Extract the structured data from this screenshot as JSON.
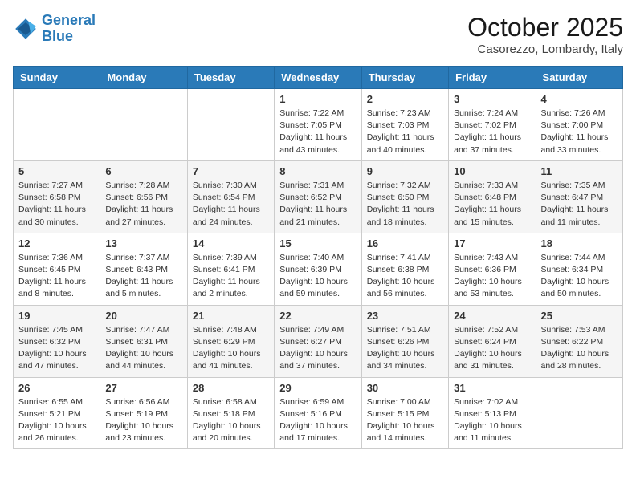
{
  "logo": {
    "line1": "General",
    "line2": "Blue"
  },
  "title": "October 2025",
  "subtitle": "Casorezzo, Lombardy, Italy",
  "weekdays": [
    "Sunday",
    "Monday",
    "Tuesday",
    "Wednesday",
    "Thursday",
    "Friday",
    "Saturday"
  ],
  "weeks": [
    [
      {
        "day": "",
        "info": ""
      },
      {
        "day": "",
        "info": ""
      },
      {
        "day": "",
        "info": ""
      },
      {
        "day": "1",
        "info": "Sunrise: 7:22 AM\nSunset: 7:05 PM\nDaylight: 11 hours\nand 43 minutes."
      },
      {
        "day": "2",
        "info": "Sunrise: 7:23 AM\nSunset: 7:03 PM\nDaylight: 11 hours\nand 40 minutes."
      },
      {
        "day": "3",
        "info": "Sunrise: 7:24 AM\nSunset: 7:02 PM\nDaylight: 11 hours\nand 37 minutes."
      },
      {
        "day": "4",
        "info": "Sunrise: 7:26 AM\nSunset: 7:00 PM\nDaylight: 11 hours\nand 33 minutes."
      }
    ],
    [
      {
        "day": "5",
        "info": "Sunrise: 7:27 AM\nSunset: 6:58 PM\nDaylight: 11 hours\nand 30 minutes."
      },
      {
        "day": "6",
        "info": "Sunrise: 7:28 AM\nSunset: 6:56 PM\nDaylight: 11 hours\nand 27 minutes."
      },
      {
        "day": "7",
        "info": "Sunrise: 7:30 AM\nSunset: 6:54 PM\nDaylight: 11 hours\nand 24 minutes."
      },
      {
        "day": "8",
        "info": "Sunrise: 7:31 AM\nSunset: 6:52 PM\nDaylight: 11 hours\nand 21 minutes."
      },
      {
        "day": "9",
        "info": "Sunrise: 7:32 AM\nSunset: 6:50 PM\nDaylight: 11 hours\nand 18 minutes."
      },
      {
        "day": "10",
        "info": "Sunrise: 7:33 AM\nSunset: 6:48 PM\nDaylight: 11 hours\nand 15 minutes."
      },
      {
        "day": "11",
        "info": "Sunrise: 7:35 AM\nSunset: 6:47 PM\nDaylight: 11 hours\nand 11 minutes."
      }
    ],
    [
      {
        "day": "12",
        "info": "Sunrise: 7:36 AM\nSunset: 6:45 PM\nDaylight: 11 hours\nand 8 minutes."
      },
      {
        "day": "13",
        "info": "Sunrise: 7:37 AM\nSunset: 6:43 PM\nDaylight: 11 hours\nand 5 minutes."
      },
      {
        "day": "14",
        "info": "Sunrise: 7:39 AM\nSunset: 6:41 PM\nDaylight: 11 hours\nand 2 minutes."
      },
      {
        "day": "15",
        "info": "Sunrise: 7:40 AM\nSunset: 6:39 PM\nDaylight: 10 hours\nand 59 minutes."
      },
      {
        "day": "16",
        "info": "Sunrise: 7:41 AM\nSunset: 6:38 PM\nDaylight: 10 hours\nand 56 minutes."
      },
      {
        "day": "17",
        "info": "Sunrise: 7:43 AM\nSunset: 6:36 PM\nDaylight: 10 hours\nand 53 minutes."
      },
      {
        "day": "18",
        "info": "Sunrise: 7:44 AM\nSunset: 6:34 PM\nDaylight: 10 hours\nand 50 minutes."
      }
    ],
    [
      {
        "day": "19",
        "info": "Sunrise: 7:45 AM\nSunset: 6:32 PM\nDaylight: 10 hours\nand 47 minutes."
      },
      {
        "day": "20",
        "info": "Sunrise: 7:47 AM\nSunset: 6:31 PM\nDaylight: 10 hours\nand 44 minutes."
      },
      {
        "day": "21",
        "info": "Sunrise: 7:48 AM\nSunset: 6:29 PM\nDaylight: 10 hours\nand 41 minutes."
      },
      {
        "day": "22",
        "info": "Sunrise: 7:49 AM\nSunset: 6:27 PM\nDaylight: 10 hours\nand 37 minutes."
      },
      {
        "day": "23",
        "info": "Sunrise: 7:51 AM\nSunset: 6:26 PM\nDaylight: 10 hours\nand 34 minutes."
      },
      {
        "day": "24",
        "info": "Sunrise: 7:52 AM\nSunset: 6:24 PM\nDaylight: 10 hours\nand 31 minutes."
      },
      {
        "day": "25",
        "info": "Sunrise: 7:53 AM\nSunset: 6:22 PM\nDaylight: 10 hours\nand 28 minutes."
      }
    ],
    [
      {
        "day": "26",
        "info": "Sunrise: 6:55 AM\nSunset: 5:21 PM\nDaylight: 10 hours\nand 26 minutes."
      },
      {
        "day": "27",
        "info": "Sunrise: 6:56 AM\nSunset: 5:19 PM\nDaylight: 10 hours\nand 23 minutes."
      },
      {
        "day": "28",
        "info": "Sunrise: 6:58 AM\nSunset: 5:18 PM\nDaylight: 10 hours\nand 20 minutes."
      },
      {
        "day": "29",
        "info": "Sunrise: 6:59 AM\nSunset: 5:16 PM\nDaylight: 10 hours\nand 17 minutes."
      },
      {
        "day": "30",
        "info": "Sunrise: 7:00 AM\nSunset: 5:15 PM\nDaylight: 10 hours\nand 14 minutes."
      },
      {
        "day": "31",
        "info": "Sunrise: 7:02 AM\nSunset: 5:13 PM\nDaylight: 10 hours\nand 11 minutes."
      },
      {
        "day": "",
        "info": ""
      }
    ]
  ]
}
